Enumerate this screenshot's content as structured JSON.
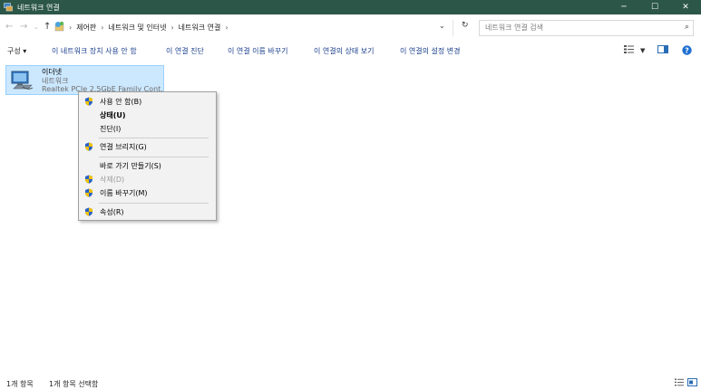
{
  "window": {
    "title": "네트워크 연결",
    "controls": {
      "minimize": "─",
      "maximize": "☐",
      "close": "✕"
    }
  },
  "address": {
    "crumbs": [
      "제어판",
      "네트워크 및 인터넷",
      "네트워크 연결"
    ],
    "separator": "›",
    "search_placeholder": "네트워크 연결 검색"
  },
  "commands": {
    "organize": "구성 ▾",
    "disable": "이 네트워크 장치 사용 안 함",
    "diagnose": "이 연결 진단",
    "rename": "이 연결 이름 바꾸기",
    "status": "이 연결의 상태 보기",
    "settings": "이 연결의 설정 변경"
  },
  "item": {
    "name": "이더넷",
    "type": "네트워크",
    "adapter": "Realtek PCIe 2.5GbE Family Cont..."
  },
  "context_menu": {
    "disable": "사용 안 함(B)",
    "status": "상태(U)",
    "diagnose": "진단(I)",
    "bridge": "연결 브리지(G)",
    "shortcut": "바로 가기 만들기(S)",
    "delete": "삭제(D)",
    "rename": "이름 바꾸기(M)",
    "properties": "속성(R)"
  },
  "status": {
    "count": "1개 항목",
    "selected": "1개 항목 선택함"
  },
  "colors": {
    "titlebar": "#2c5748",
    "selection": "#cce8ff",
    "link": "#1a3e8c"
  }
}
